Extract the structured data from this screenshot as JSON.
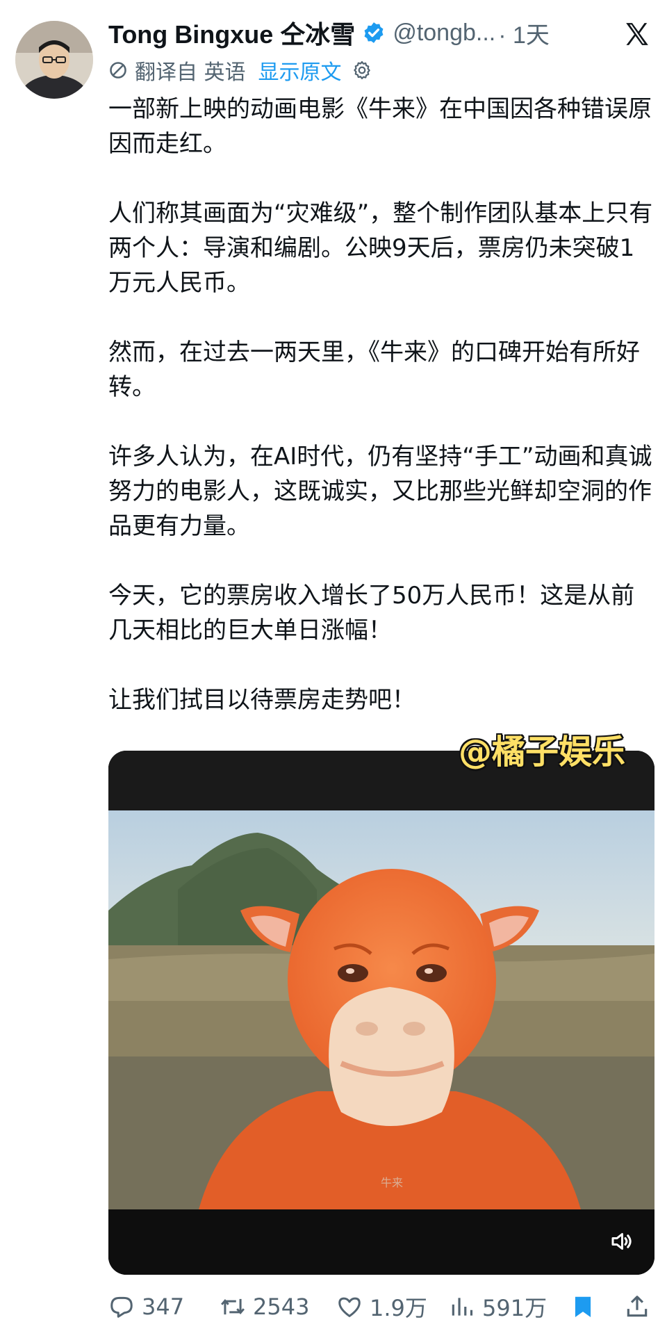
{
  "post": {
    "author_name": "Tong Bingxue 仝冰雪",
    "handle": "@tongb...",
    "time": "· 1天",
    "translation": {
      "note": "翻译自 英语",
      "show_original": "显示原文"
    },
    "paragraphs": [
      "一部新上映的动画电影《牛来》在中国因各种错误原因而走红。",
      "人们称其画面为“灾难级”，整个制作团队基本上只有两个人：导演和编剧。公映9天后，票房仍未突破1万元人民币。",
      "然而，在过去一两天里，《牛来》的口碑开始有所好转。",
      "许多人认为，在AI时代，仍有坚持“手工”动画和真诚努力的电影人，这既诚实，又比那些光鲜却空洞的作品更有力量。",
      "今天，它的票房收入增长了50万人民币！这是从前几天相比的巨大单日涨幅！",
      "让我们拭目以待票房走势吧！"
    ],
    "media": {
      "watermark": "@橘子娱乐",
      "subtitle": "牛来"
    },
    "actions": {
      "replies": "347",
      "retweets": "2543",
      "likes": "1.9万",
      "views": "591万"
    }
  },
  "colors": {
    "verified": "#1d9bf0",
    "link": "#1d9bf0",
    "muted": "#536471",
    "text": "#0f1419"
  },
  "icons": [
    "x-logo-icon",
    "verified-badge-icon",
    "translate-icon",
    "gear-icon",
    "reply-icon",
    "retweet-icon",
    "like-icon",
    "views-icon",
    "bookmark-icon",
    "share-icon",
    "sound-icon"
  ]
}
